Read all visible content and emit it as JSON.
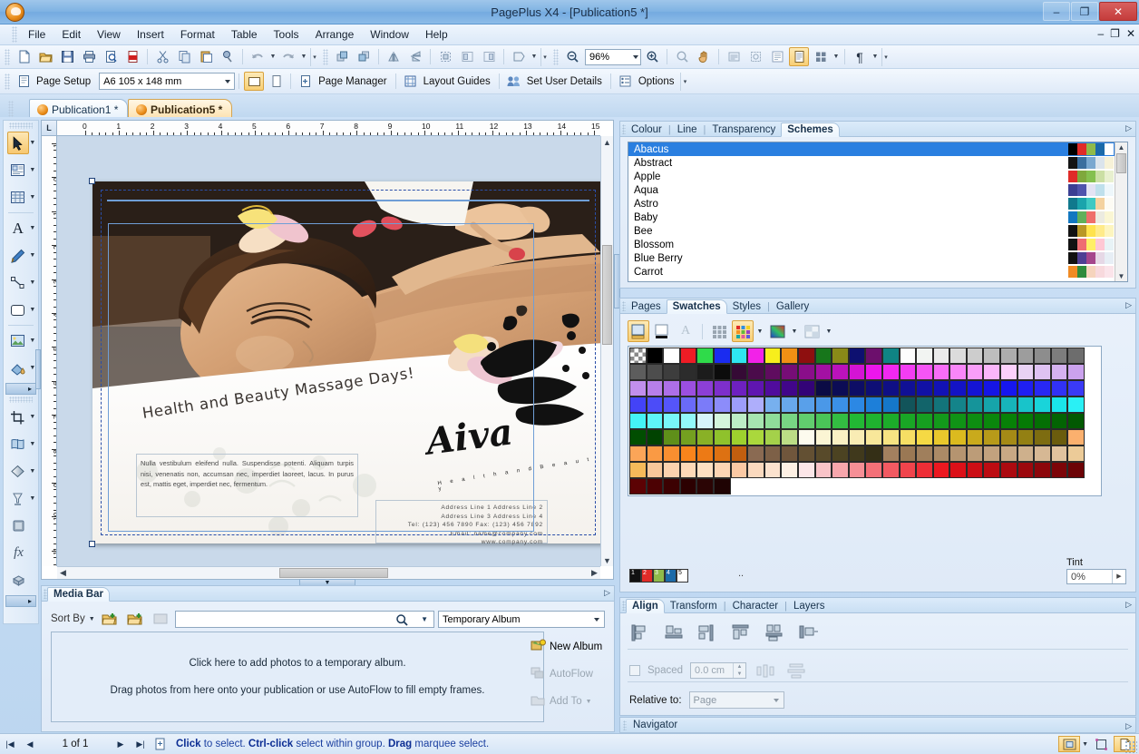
{
  "window": {
    "title": "PagePlus X4 - [Publication5 *]",
    "minimize": "–",
    "maximize": "❐",
    "close": "✕",
    "mdi_min": "–",
    "mdi_restore": "❐",
    "mdi_close": "✕",
    "app_icon": "pageplus-logo-icon"
  },
  "menu": [
    "File",
    "Edit",
    "View",
    "Insert",
    "Format",
    "Table",
    "Tools",
    "Arrange",
    "Window",
    "Help"
  ],
  "toolbar_standard": {
    "icons": [
      "new-document-icon",
      "open-folder-icon",
      "save-icon",
      "print-icon",
      "print-preview-icon",
      "pdf-export-icon",
      "cut-icon",
      "copy-icon",
      "paste-icon",
      "format-painter-icon",
      "undo-icon",
      "redo-icon",
      "bring-forward-icon",
      "send-backward-icon",
      "flip-horizontal-icon",
      "flip-vertical-icon",
      "group-icon",
      "align-left-icon",
      "align-right-icon",
      "shape-icon"
    ],
    "zoom_out": "zoom-out-icon",
    "zoom_value": "96%",
    "zoom_in": "zoom-in-icon",
    "pan_tools": [
      "zoom-tool-icon",
      "pan-hand-icon",
      "fit-width-icon",
      "fit-page-icon",
      "two-page-icon",
      "single-page-icon",
      "thumbnails-icon"
    ],
    "paragraph_marks": "¶"
  },
  "toolbar_page": {
    "page_setup_label": "Page Setup",
    "page_size": "A6 105 x 148 mm",
    "orientation_landscape": "landscape-icon",
    "orientation_portrait": "portrait-icon",
    "page_manager_label": "Page Manager",
    "layout_guides_label": "Layout Guides",
    "user_details_label": "Set User Details",
    "options_label": "Options"
  },
  "document_tabs": [
    {
      "label": "Publication1 *",
      "selected": false
    },
    {
      "label": "Publication5 *",
      "selected": true
    }
  ],
  "tools_palette_top": [
    {
      "name": "pointer-tool",
      "selected": true,
      "has_arrow": true
    },
    {
      "name": "text-frame-tool",
      "selected": false,
      "has_arrow": true
    },
    {
      "name": "table-tool",
      "selected": false,
      "has_arrow": true
    },
    {
      "name": "artistic-text-tool",
      "selected": false,
      "has_arrow": true
    },
    {
      "name": "pencil-tool",
      "selected": false,
      "has_arrow": true
    },
    {
      "name": "line-tool",
      "selected": false,
      "has_arrow": true
    },
    {
      "name": "rectangle-tool",
      "selected": false,
      "has_arrow": true
    },
    {
      "name": "picture-frame-tool",
      "selected": false,
      "has_arrow": true
    },
    {
      "name": "fill-tool",
      "selected": false,
      "has_arrow": true
    }
  ],
  "tools_palette_bottom": [
    {
      "name": "crop-tool",
      "selected": false,
      "has_arrow": true
    },
    {
      "name": "mesh-warp-tool",
      "selected": false,
      "has_arrow": true
    },
    {
      "name": "transparency-tool",
      "selected": false,
      "has_arrow": true
    },
    {
      "name": "shadow-tool",
      "selected": false,
      "has_arrow": true
    },
    {
      "name": "bevel-tool",
      "selected": false,
      "has_arrow": false
    },
    {
      "name": "effects-tool",
      "selected": false,
      "has_arrow": false
    },
    {
      "name": "3d-filter-tool",
      "selected": false,
      "has_arrow": false
    }
  ],
  "ruler": {
    "h_ticks": [
      "0",
      "1",
      "2",
      "3",
      "4",
      "5",
      "6",
      "7",
      "8",
      "9",
      "10",
      "11",
      "12",
      "13",
      "14",
      "15"
    ],
    "v_ticks": [
      "1",
      "0",
      "1",
      "2",
      "3",
      "4",
      "5",
      "6",
      "7",
      "8",
      "9",
      "10",
      "11"
    ],
    "corner": "L"
  },
  "flyer": {
    "headline": "Health and Beauty Massage Days!",
    "body": "Nulla vestibulum eleifend nulla. Suspendisse potenti. Aliquam turpis nisi, venenatis non, accumsan nec, imperdiet laoreet, lacus. In purus est, mattis eget, imperdiet nec, fermentum.",
    "logo": "Aiva",
    "logo_sub": "H e a l t h   a n d   B e a u t y",
    "address": [
      "Address Line 1 Address Line 2",
      "Address Line 3 Address Line 4",
      "Tel: (123) 456 7890  Fax: (123) 456 7892",
      "Email: name@company.com",
      "www.company.com"
    ]
  },
  "schemes_panel": {
    "tabs": [
      {
        "label": "Colour",
        "selected": false
      },
      {
        "label": "Line",
        "selected": false
      },
      {
        "label": "Transparency",
        "selected": false
      },
      {
        "label": "Schemes",
        "selected": true
      }
    ],
    "items": [
      {
        "name": "Abacus",
        "selected": true,
        "colors": [
          "#000000",
          "#e02b28",
          "#8fba4a",
          "#1b6aa8",
          "#ffffff"
        ]
      },
      {
        "name": "Abstract",
        "selected": false,
        "colors": [
          "#141414",
          "#3a6e9e",
          "#7aa8d0",
          "#dbe4ec",
          "#f7f2d8"
        ]
      },
      {
        "name": "Apple",
        "selected": false,
        "colors": [
          "#e02b28",
          "#7fa83c",
          "#85c04f",
          "#cbdfa4",
          "#e8f0cf"
        ]
      },
      {
        "name": "Aqua",
        "selected": false,
        "colors": [
          "#3b3f93",
          "#4f54ad",
          "#e3e3f4",
          "#bfe0ec",
          "#eef7fb"
        ]
      },
      {
        "name": "Astro",
        "selected": false,
        "colors": [
          "#10798d",
          "#1aa4ac",
          "#3ec9c3",
          "#f4d2a0",
          "#fdfbf4"
        ]
      },
      {
        "name": "Baby",
        "selected": false,
        "colors": [
          "#1277c0",
          "#61b05a",
          "#ef6e6a",
          "#ecebe0",
          "#faf6d4"
        ]
      },
      {
        "name": "Bee",
        "selected": false,
        "colors": [
          "#121212",
          "#b99726",
          "#ffe34d",
          "#ffeb8a",
          "#fdf5bf"
        ]
      },
      {
        "name": "Blossom",
        "selected": false,
        "colors": [
          "#131313",
          "#ef6d72",
          "#ffef66",
          "#ffc8d4",
          "#e8f3f6"
        ]
      },
      {
        "name": "Blue Berry",
        "selected": false,
        "colors": [
          "#111111",
          "#4e3f93",
          "#a5468c",
          "#e6d8e6",
          "#e7eef5"
        ]
      },
      {
        "name": "Carrot",
        "selected": false,
        "colors": [
          "#f08b24",
          "#2f8b3c",
          "#f6d4bd",
          "#f8d9dd",
          "#fbe4ea"
        ]
      }
    ]
  },
  "swatches_panel": {
    "tabs": [
      {
        "label": "Pages",
        "selected": false
      },
      {
        "label": "Swatches",
        "selected": true
      },
      {
        "label": "Styles",
        "selected": false
      },
      {
        "label": "Gallery",
        "selected": false
      }
    ],
    "tools": [
      "fill-swatch-icon",
      "line-swatch-icon",
      "text-swatch-icon",
      "palette-grey-icon",
      "palette-color-icon",
      "gradient-fill-icon",
      "bitmap-fill-icon"
    ],
    "scheme_color_labels": [
      "1",
      "2",
      "3",
      "4",
      "5"
    ],
    "scheme_colors": [
      "#111111",
      "#e02b28",
      "#8fba4a",
      "#1b6aa8",
      "#ffffff"
    ],
    "tint_label": "Tint",
    "tint_value": "0%",
    "colors": [
      "none",
      "#000000",
      "#ffffff",
      "#ee1c25",
      "#2fdb4a",
      "#1a2cf0",
      "#2ee6f0",
      "#f222e8",
      "#f7ee1c",
      "#f09014",
      "#8e0f0f",
      "#17761b",
      "#8a8a18",
      "#0d1070",
      "#6c0f6c",
      "#0f8484",
      "#fdfdfd",
      "#f2f4f2",
      "#eaeaea",
      "#dcdcdc",
      "#cdcdcd",
      "#bdbdbd",
      "#adadad",
      "#9d9d9d",
      "#8d8d8d",
      "#7d7d7d",
      "#6d6d6d",
      "#5d5d5d",
      "#4d4d4d",
      "#3d3d3d",
      "#2c2c2c",
      "#1c1c1c",
      "#0c0c0c",
      "#350a35",
      "#4b0b4b",
      "#5f0c5f",
      "#760d76",
      "#8a0e8a",
      "#a310a3",
      "#bb12bb",
      "#d414d4",
      "#ec16ec",
      "#f028f0",
      "#f33df3",
      "#f555f5",
      "#f76df7",
      "#f886f8",
      "#f99ef9",
      "#fbb6fb",
      "#fcd0fc",
      "#e9d2f4",
      "#dfc2f2",
      "#d5b2f0",
      "#cba2ee",
      "#c18fec",
      "#b77fea",
      "#ad6fe8",
      "#9b4fe0",
      "#8c3fd6",
      "#7d2fcb",
      "#6e20c0",
      "#5f15b0",
      "#500c9d",
      "#41068a",
      "#330377",
      "#0b0b45",
      "#0c0c55",
      "#0d0d65",
      "#0e0e75",
      "#0f0f85",
      "#101095",
      "#1111a5",
      "#1212b5",
      "#1313c5",
      "#1414d5",
      "#1515e5",
      "#1616f0",
      "#1f1ff2",
      "#2828f4",
      "#3131f5",
      "#3a3af6",
      "#4343f7",
      "#4c4cf8",
      "#5555f9",
      "#6a6af8",
      "#7b7bf9",
      "#8c8cfa",
      "#9d9dfa",
      "#aeaefb",
      "#77b0ee",
      "#68a8ec",
      "#59a0ea",
      "#4a98e8",
      "#3b90e6",
      "#2c88e4",
      "#1d7fd9",
      "#1577c9",
      "#12545a",
      "#12646a",
      "#13747a",
      "#14848a",
      "#15949a",
      "#16a4aa",
      "#17b4ba",
      "#18c4ca",
      "#19d4da",
      "#1ae4ea",
      "#2af0f5",
      "#44f2f7",
      "#5ef4f8",
      "#78f6f9",
      "#92f8fa",
      "#d6f4fb",
      "#d4f5dc",
      "#bdedc6",
      "#a6e5b0",
      "#8fdd9a",
      "#78d584",
      "#61cd6e",
      "#4ac558",
      "#33bd42",
      "#22b834",
      "#1fb22f",
      "#1cac2a",
      "#19a625",
      "#169f20",
      "#13991b",
      "#109316",
      "#0d8d11",
      "#0a870c",
      "#078107",
      "#057a05",
      "#046f04",
      "#036403",
      "#025902",
      "#014e01",
      "#014301",
      "#5f8f1a",
      "#74a020",
      "#89b126",
      "#8fc22c",
      "#9ed12e",
      "#aad83c",
      "#a4d14a",
      "#bcdd86",
      "#fdfbee",
      "#fbf5d4",
      "#faf0c4",
      "#f9ecb4",
      "#f8e79a",
      "#f7e382",
      "#f6de64",
      "#f5d944",
      "#e9c82c",
      "#dbba1f",
      "#c9aa1c",
      "#b79a19",
      "#a58a16",
      "#938013",
      "#7d6c10",
      "#6b5c0d",
      "#fbb06e",
      "#fba558",
      "#fa9a44",
      "#f98f30",
      "#f8841c",
      "#ed7a15",
      "#dd7112",
      "#c25e0f",
      "#8a6a52",
      "#7d6047",
      "#70563c",
      "#635033",
      "#584a2a",
      "#4c4322",
      "#40391c",
      "#342f16",
      "#a3805f",
      "#9a7854",
      "#a07f5c",
      "#ab8a66",
      "#b59470",
      "#bc9c78",
      "#c2a27e",
      "#c8a884",
      "#ceb08c",
      "#d6b894",
      "#e0c29e",
      "#eccb98",
      "#f5ba5a",
      "#f7c79a",
      "#fbd2ae",
      "#fcd9b8",
      "#fde0c2",
      "#fcd5b4",
      "#fbc9a4",
      "#fad9be",
      "#fbe2ce",
      "#fdf0e4",
      "#fce6e8",
      "#f9c3c8",
      "#f7a6ac",
      "#f68f96",
      "#f47078",
      "#f25a62",
      "#f0444c",
      "#ee2e36",
      "#ec1820",
      "#dc1018",
      "#cc0e15",
      "#bc0c12",
      "#ac0a10",
      "#9c080d",
      "#8c060b",
      "#7c0408",
      "#6c0306",
      "#5c0204",
      "#4c0103",
      "#3c0102",
      "#2c0001",
      "#2b0505",
      "#1f0303"
    ]
  },
  "align_panel": {
    "tabs": [
      {
        "label": "Align",
        "selected": true
      },
      {
        "label": "Transform",
        "selected": false
      },
      {
        "label": "Character",
        "selected": false
      },
      {
        "label": "Layers",
        "selected": false
      }
    ],
    "buttons": [
      "align-left-icon",
      "align-centre-horiz-icon",
      "align-right-icon",
      "align-top-icon",
      "align-middle-vert-icon",
      "align-bottom-icon"
    ],
    "spaced_label": "Spaced",
    "spaced_value": "0.0 cm",
    "distribute_horiz": "distribute-horizontally-icon",
    "distribute_vert": "distribute-vertically-icon",
    "relative_label": "Relative to:",
    "relative_value": "Page"
  },
  "navigator_panel": {
    "label": "Navigator"
  },
  "media_bar": {
    "tabs": [
      {
        "label": "Media Bar",
        "selected": true
      }
    ],
    "sort_by_label": "Sort By",
    "icons": [
      "add-photos-icon",
      "add-folder-icon",
      "remove-photo-icon",
      "search-icon",
      "search-dropdown-icon"
    ],
    "search_value": "",
    "album_value": "Temporary Album",
    "drop_line1": "Click here to add photos to a temporary album.",
    "drop_line2": "Drag photos from here onto your publication or use AutoFlow to fill empty frames.",
    "side_buttons": [
      {
        "label": "New Album",
        "icon": "new-album-icon",
        "disabled": false
      },
      {
        "label": "AutoFlow",
        "icon": "autoflow-icon",
        "disabled": true
      },
      {
        "label": "Add To",
        "icon": "add-to-icon",
        "disabled": true
      }
    ]
  },
  "status_bar": {
    "first_icon": "first-page-icon",
    "prev_icon": "previous-page-icon",
    "page_text": "1 of 1",
    "next_icon": "next-page-icon",
    "last_icon": "last-page-icon",
    "doc_icon": "page-icon",
    "message_parts": [
      {
        "text": "Click",
        "bold": true
      },
      {
        "text": " to select. ",
        "bold": false
      },
      {
        "text": "Ctrl-click",
        "bold": true
      },
      {
        "text": " select within group. ",
        "bold": false
      },
      {
        "text": "Drag",
        "bold": true
      },
      {
        "text": " marquee select.",
        "bold": false
      }
    ],
    "right_buttons": [
      "select-object-icon",
      "bounding-box-icon",
      "page-view-icon"
    ]
  },
  "colors": {
    "title_bar": "#7fb3e3",
    "accent_orange": "#f8cf75",
    "selection_blue": "#2a7fe0",
    "panel_bg": "#e3eefa",
    "status_text": "#1a3fa0"
  }
}
